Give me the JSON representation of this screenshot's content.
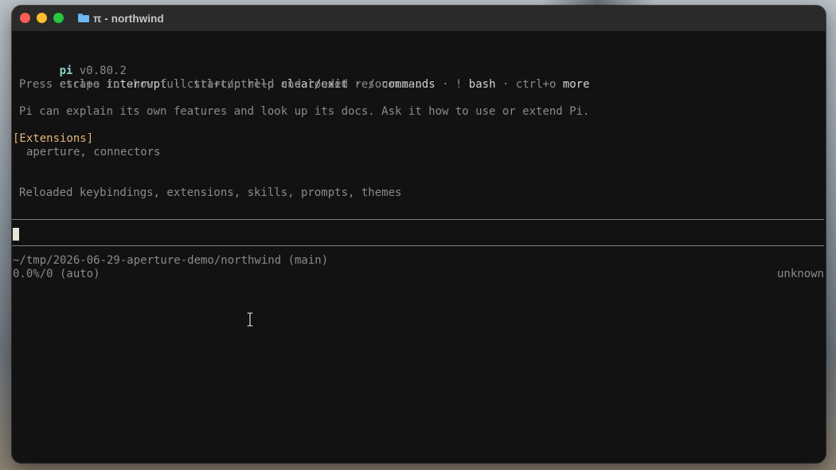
{
  "window": {
    "title": "π - northwind"
  },
  "terminal": {
    "header": {
      "app_name": "pi",
      "version": "v0.80.2"
    },
    "keys_line": [
      {
        "text": "escape ",
        "style": "dim"
      },
      {
        "text": "interrupt",
        "style": "white"
      },
      {
        "text": " · ctrl+c/ctrl+d ",
        "style": "dim"
      },
      {
        "text": "clear/exit",
        "style": "white"
      },
      {
        "text": " · / ",
        "style": "dim"
      },
      {
        "text": "commands",
        "style": "white"
      },
      {
        "text": " · ! ",
        "style": "dim"
      },
      {
        "text": "bash",
        "style": "white"
      },
      {
        "text": " · ctrl+o ",
        "style": "dim"
      },
      {
        "text": "more",
        "style": "white"
      }
    ],
    "startup_hint": "Press ctrl+o to show full startup help and loaded resources.",
    "docs_hint": "Pi can explain its own features and look up its docs. Ask it how to use or extend Pi.",
    "extensions_header": "[Extensions]",
    "extensions_list": "aperture, connectors",
    "reload_message": "Reloaded keybindings, extensions, skills, prompts, themes",
    "status": {
      "path": "~/tmp/2026-06-29-aperture-demo/northwind (main)",
      "usage": "0.0%/0 (auto)",
      "model": "unknown"
    }
  },
  "colors": {
    "accent": "#8ad0cc",
    "extensions_header": "#e8b27a",
    "background": "#121212"
  }
}
